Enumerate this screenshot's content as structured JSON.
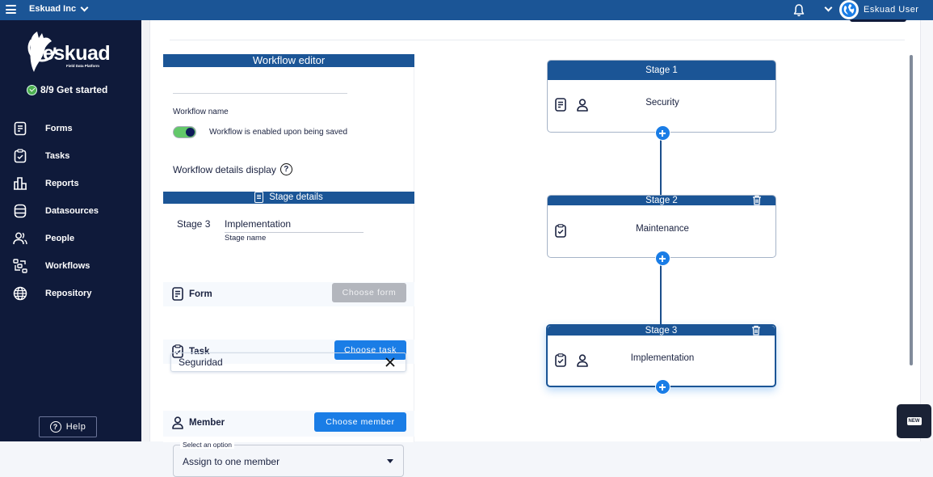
{
  "topbar": {
    "org_name": "Eskuad Inc",
    "user_name": "Eskuad User",
    "icons": [
      "menu-icon",
      "chevron-down-icon",
      "bell-icon",
      "chevron-down-icon",
      "globe-icon"
    ]
  },
  "sidebar": {
    "logo_text": "eskuad",
    "logo_subtitle": "Field Data Platform",
    "get_started": "8/9 Get started",
    "items": [
      {
        "label": "Forms",
        "icon": "form-icon"
      },
      {
        "label": "Tasks",
        "icon": "clipboard-check-icon"
      },
      {
        "label": "Reports",
        "icon": "bar-chart-icon"
      },
      {
        "label": "Datasources",
        "icon": "database-icon"
      },
      {
        "label": "People",
        "icon": "people-icon"
      },
      {
        "label": "Workflows",
        "icon": "workflow-icon"
      },
      {
        "label": "Repository",
        "icon": "globe-icon"
      }
    ],
    "help_label": "Help"
  },
  "editor": {
    "title": "Workflow editor",
    "workflow_name_value": "",
    "workflow_name_label": "Workflow name",
    "toggle_enabled": true,
    "toggle_label": "Workflow is enabled upon being saved",
    "details_display_label": "Workflow details display",
    "stage_details_title": "Stage details",
    "stage_number": "Stage 3",
    "stage_name_value": "Implementation",
    "stage_name_label": "Stage name",
    "form_section": {
      "label": "Form",
      "button": "Choose form",
      "button_disabled": true
    },
    "task_section": {
      "label": "Task",
      "button": "Choose task",
      "selected_task": "Seguridad"
    },
    "member_section": {
      "label": "Member",
      "button": "Choose member",
      "select_legend": "Select an option",
      "select_value": "Assign to one member"
    }
  },
  "stages": [
    {
      "header": "Stage 1",
      "name": "Security",
      "has_form": true,
      "has_task": false,
      "has_member": true,
      "deletable": false,
      "active": false
    },
    {
      "header": "Stage 2",
      "name": "Maintenance",
      "has_form": false,
      "has_task": true,
      "has_member": false,
      "deletable": true,
      "active": false
    },
    {
      "header": "Stage 3",
      "name": "Implementation",
      "has_form": false,
      "has_task": true,
      "has_member": true,
      "deletable": true,
      "active": true
    }
  ],
  "new_badge": "NEW",
  "colors": {
    "topbar": "#1b5596",
    "sidebar": "#0f1a3a",
    "primary_button": "#1a7de6",
    "disabled_button": "#b3b6bd",
    "toggle_on": "#63c86a"
  }
}
